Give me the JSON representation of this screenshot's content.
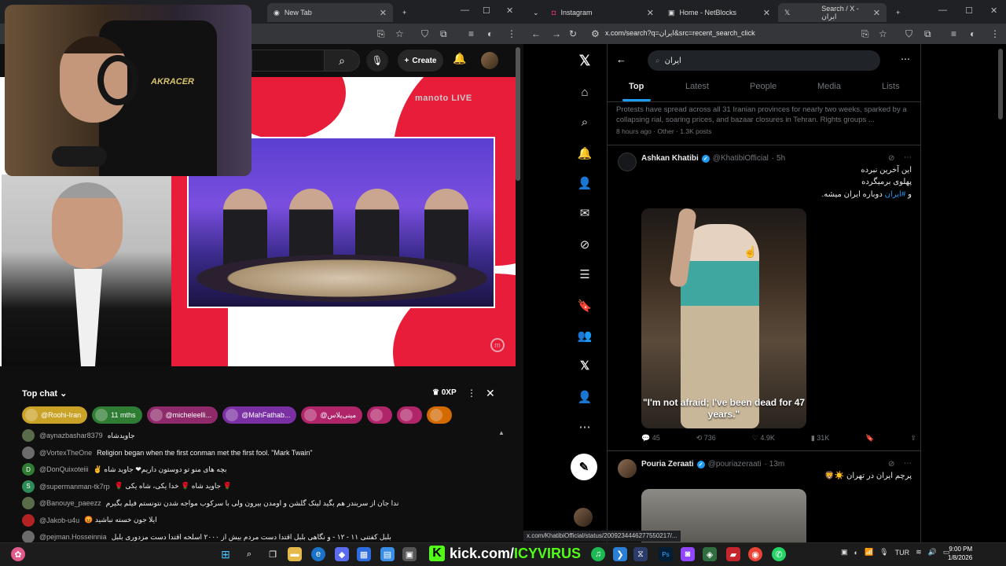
{
  "left_browser": {
    "tabs": [
      {
        "label": "New Tab"
      }
    ],
    "youtube": {
      "create_label": "Create",
      "channel_watermark": "manoto LIVE",
      "chair_brand": "AKRACER",
      "chat": {
        "title": "Top chat",
        "xp": "0XP",
        "pills": [
          {
            "label": "@Roohi-Iran",
            "color": "#c9a227"
          },
          {
            "label": "11 mths",
            "color": "#2e7d32"
          },
          {
            "label": "@micheleelli...",
            "color": "#8e2a6a"
          },
          {
            "label": "@MahFathab...",
            "color": "#7a2fa3"
          },
          {
            "label": "@مینی‌پلاس",
            "color": "#b0246a"
          },
          {
            "label": "",
            "color": "#b0246a"
          },
          {
            "label": "",
            "color": "#b0246a"
          },
          {
            "label": "",
            "color": "#d26a00"
          }
        ],
        "messages": [
          {
            "user": "@aynazbashar8379",
            "text": "جاویدشاه",
            "avatar_color": "#5a6b4a",
            "initial": ""
          },
          {
            "user": "@VortexTheOne",
            "text": "Religion began when the first conman met the first fool. \"Mark Twain\"",
            "avatar_color": "#6b6b6b",
            "initial": ""
          },
          {
            "user": "@DonQuixoteiii",
            "text": "✌ بچه های منو تو دوستون داریم❤ جاوید شاه",
            "avatar_color": "#2e7d32",
            "initial": "D"
          },
          {
            "user": "@supermanman-tk7rp",
            "text": "🌹 جاوید شاه 🌹 خدا یکی، شاه یکی 🌹",
            "avatar_color": "#2e8b57",
            "initial": "S"
          },
          {
            "user": "@Banouye_paeezz",
            "text": "ندا جان از سربندر هم بگید لینک گلشن و اومدن بیرون ولی با سرکوب مواجه شدن نتونستم فیلم بگیرم",
            "avatar_color": "#5a6b4a",
            "initial": ""
          },
          {
            "user": "@Jakob-u4u",
            "text": "😡 ایلا جون خسته نباشید",
            "avatar_color": "#b22222",
            "initial": ""
          },
          {
            "user": "@pejman.Hosseinnia",
            "text": "بلبل کفتنی ۱۱ - ۱۲ - و نگاهی بلبل اقتدا دست مردم بیش از ۲۰۰۰ اسلحه اقتدا دست مزدوری بلبل",
            "avatar_color": "#6b6b6b",
            "initial": ""
          }
        ]
      }
    }
  },
  "right_browser": {
    "tabs": [
      {
        "label": "Instagram"
      },
      {
        "label": "Home - NetBlocks"
      },
      {
        "label": "Search / X - ایران"
      }
    ],
    "url": "x.com/search?q=ایران&src=recent_search_click",
    "x": {
      "search_query": "ایران",
      "tabs": [
        "Top",
        "Latest",
        "People",
        "Media",
        "Lists"
      ],
      "active_tab": "Top",
      "trend": {
        "text": "Protests have spread across all 31 Iranian provinces for nearly two weeks, sparked by a collapsing rial, soaring prices, and bazaar closures in Tehran. Rights groups ...",
        "meta": "8 hours ago · Other · 1.3K posts"
      },
      "post1": {
        "name": "Ashkan Khatibi",
        "handle": "@KhatibiOfficial",
        "time": "· 5h",
        "line1": "این آخرین نبرده",
        "line2": "پهلوی برمیگرده",
        "line3_prefix": "و",
        "line3_hashtag": "#ایران",
        "line3_suffix": "دوباره ایران میشه.",
        "image_caption": "\"I'm not afraid; I've been dead for 47 years.\"",
        "stats": {
          "replies": "45",
          "reposts": "736",
          "likes": "4.9K",
          "views": "31K"
        }
      },
      "post2": {
        "name": "Pouria Zeraati",
        "handle": "@pouriazeraati",
        "time": "· 13m",
        "text": "پرچم ایران در تهران ☀️🦁"
      },
      "status_url": "x.com/KhatibiOfficial/status/2009234446277550217/..."
    }
  },
  "taskbar": {
    "kick_text_prefix": "kick.com/",
    "kick_text_name": "ICYVIRUS",
    "lang": "TUR",
    "time": "9:00 PM",
    "date": "1/8/2026"
  },
  "colors": {
    "x_blue": "#1d9bf0",
    "yt_red": "#e81d3a",
    "kick_green": "#53fc18"
  }
}
